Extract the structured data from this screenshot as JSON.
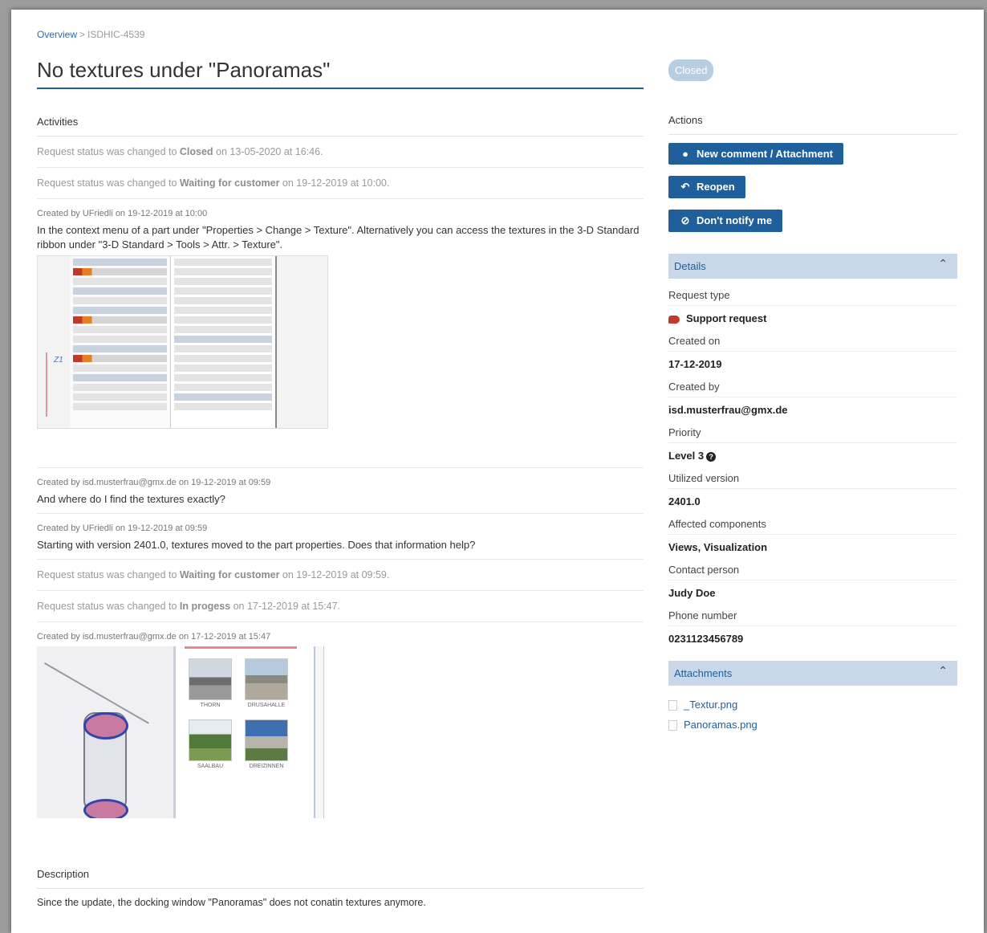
{
  "breadcrumb": {
    "overview": "Overview",
    "separator": ">",
    "ticket_id": "ISDHIC-4539"
  },
  "title": "No textures under \"Panoramas\"",
  "status_badge": "Closed",
  "activities": {
    "title": "Activities",
    "status_1": {
      "prefix": "Request status was changed to ",
      "status": "Closed",
      "suffix": " on 13-05-2020 at 16:46."
    },
    "status_2": {
      "prefix": "Request status was changed to ",
      "status": "Waiting for customer",
      "suffix": " on 19-12-2019 at 10:00."
    },
    "comment_1": {
      "meta": "Created by UFriedli on 19-12-2019 at 10:00",
      "body": "In the context menu of a part under \"Properties > Change > Texture\". Alternatively you can access the textures in the 3-D Standard ribbon under \"3-D Standard > Tools > Attr. > Texture\"."
    },
    "comment_2": {
      "meta": "Created by isd.musterfrau@gmx.de on 19-12-2019 at 09:59",
      "body": "And where do I find the textures exactly?"
    },
    "comment_3": {
      "meta": "Created by UFriedli on 19-12-2019 at 09:59",
      "body": "Starting with version 2401.0, textures moved to the part properties. Does that information help?"
    },
    "status_3": {
      "prefix": "Request status was changed to ",
      "status": "Waiting for customer",
      "suffix": " on 19-12-2019 at 09:59."
    },
    "status_4": {
      "prefix": "Request status was changed to ",
      "status": "In progess",
      "suffix": " on 17-12-2019 at 15:47."
    },
    "comment_4": {
      "meta": "Created by isd.musterfrau@gmx.de on 17-12-2019 at 15:47"
    },
    "screenshot_labels": {
      "z_axis": "Z1",
      "thumb_1": "THORN",
      "thumb_2": "DRUSAHALLE",
      "thumb_3": "SAALBAU",
      "thumb_4": "DREIZINNEN"
    }
  },
  "description": {
    "title": "Description",
    "text": "Since the update, the docking window \"Panoramas\" does not conatin textures anymore."
  },
  "actions": {
    "title": "Actions",
    "new_comment": "New comment / Attachment",
    "reopen": "Reopen",
    "dont_notify": "Don't notify me"
  },
  "details": {
    "title": "Details",
    "request_type_label": "Request type",
    "request_type_value": "Support request",
    "created_on_label": "Created on",
    "created_on_value": "17-12-2019",
    "created_by_label": "Created by",
    "created_by_value": "isd.musterfrau@gmx.de",
    "priority_label": "Priority",
    "priority_value": "Level 3",
    "version_label": "Utilized version",
    "version_value": "2401.0",
    "components_label": "Affected components",
    "components_value": "Views, Visualization",
    "contact_label": "Contact person",
    "contact_value": "Judy Doe",
    "phone_label": "Phone number",
    "phone_value": "0231123456789"
  },
  "attachments": {
    "title": "Attachments",
    "files": [
      "_Textur.png",
      "Panoramas.png"
    ]
  },
  "colors": {
    "accent": "#1f5f9b",
    "panel_header_bg": "#c8d8e8",
    "badge_bg": "#b9cde2"
  },
  "icons": {
    "comment": "speech-bubble-icon",
    "reopen": "undo-icon",
    "notify": "eye-slash-icon",
    "collapse": "chevron-up-icon",
    "help": "question-circle-icon"
  }
}
